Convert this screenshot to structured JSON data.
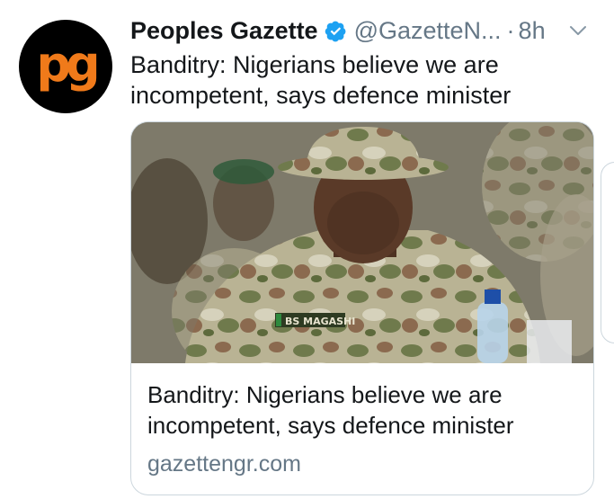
{
  "tweet": {
    "author_name": "Peoples Gazette",
    "handle": "@GazetteN...",
    "separator": "·",
    "time": "8h",
    "avatar_text": "pg",
    "text": "Banditry: Nigerians believe we are incompetent, says defence minister"
  },
  "card": {
    "title": "Banditry: Nigerians believe we are incompetent, says defence minister",
    "domain": "gazettengr.com",
    "name_tag": "BS MAGASHI"
  },
  "icons": {
    "verified": "verified-badge-icon",
    "caret": "chevron-down-icon"
  },
  "colors": {
    "accent": "#1da1f2",
    "brand_orange": "#f07a1a",
    "muted": "#657786",
    "border": "#ccd6dd"
  }
}
